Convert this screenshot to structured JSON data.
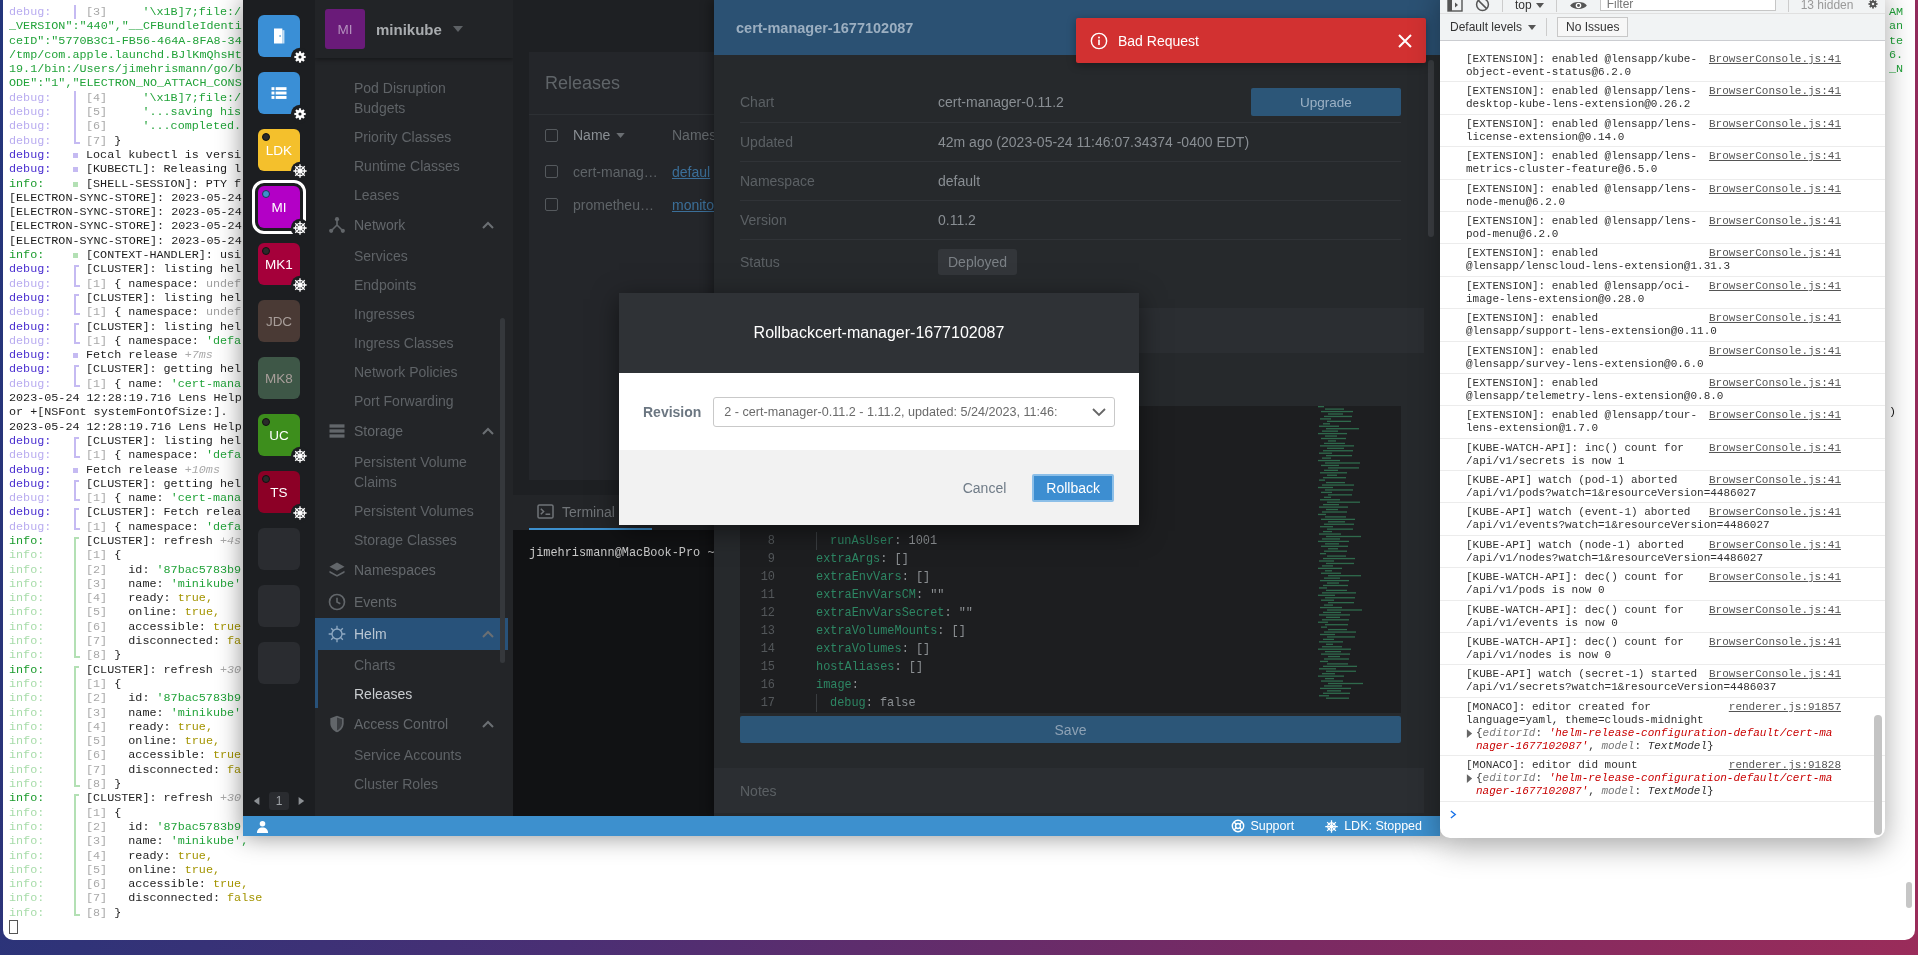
{
  "terminal": {
    "lines": [
      {
        "kind": "debug-sub",
        "label": "debug:",
        "marker": {
          "kind": "line"
        },
        "index": "[3]",
        "value": {
          "kind": "string",
          "text": "     '\\x1B]7;file:/"
        },
        "tail": {
          "kind": "string",
          "text": "AM"
        }
      },
      {
        "kind": "raw-string",
        "text": "_VERSION\":\"440\",\"__CFBundleIdenti",
        "tail": {
          "kind": "string",
          "text": "an"
        }
      },
      {
        "kind": "raw-string",
        "text": "ceID\":\"5770B3C1-FB56-464A-8FA8-34",
        "tail": {
          "kind": "string",
          "text": "te"
        }
      },
      {
        "kind": "raw-string",
        "text": "/tmp/com.apple.launchd.BJlKmQhsHt",
        "tail": {
          "kind": "string",
          "text": "6."
        }
      },
      {
        "kind": "raw-string",
        "text": "19.1/bin:/Users/jimehrismann/go/b",
        "tail": {
          "kind": "string",
          "text": "_N"
        }
      },
      {
        "kind": "raw-string",
        "text": "ODE\":\"1\",\"ELECTRON_NO_ATTACH_CONS"
      },
      {
        "kind": "debug-sub",
        "label": "debug:",
        "marker": {
          "kind": "line"
        },
        "index": "[4]",
        "value": {
          "kind": "string",
          "text": "     '\\x1B]7;file:/"
        }
      },
      {
        "kind": "debug-sub",
        "label": "debug:",
        "marker": {
          "kind": "line"
        },
        "index": "[5]",
        "value": {
          "kind": "string",
          "text": "     '...saving his"
        }
      },
      {
        "kind": "debug-sub",
        "label": "debug:",
        "marker": {
          "kind": "line"
        },
        "index": "[6]",
        "value": {
          "kind": "string",
          "text": "     '...completed."
        }
      },
      {
        "kind": "debug-sub",
        "label": "debug:",
        "marker": {
          "kind": "close"
        },
        "index": "[7]",
        "text": " }"
      },
      {
        "kind": "debug",
        "label": "debug:",
        "marker": {
          "kind": "dot"
        },
        "text": "Local kubectl is versi"
      },
      {
        "kind": "debug",
        "label": "debug:",
        "marker": {
          "kind": "dot"
        },
        "text": "[KUBECTL]: Releasing l"
      },
      {
        "kind": "info",
        "label": "info:",
        "marker": {
          "kind": "dot"
        },
        "text": "[SHELL-SESSION]: PTY f"
      },
      {
        "kind": "raw",
        "text": "[ELECTRON-SYNC-STORE]: 2023-05-24"
      },
      {
        "kind": "raw",
        "text": "[ELECTRON-SYNC-STORE]: 2023-05-24"
      },
      {
        "kind": "raw",
        "text": "[ELECTRON-SYNC-STORE]: 2023-05-24"
      },
      {
        "kind": "raw",
        "text": "[ELECTRON-SYNC-STORE]: 2023-05-24"
      },
      {
        "kind": "info",
        "label": "info:",
        "marker": {
          "kind": "dot"
        },
        "text": "[CONTEXT-HANDLER]: usi"
      },
      {
        "kind": "debug",
        "label": "debug:",
        "marker": {
          "kind": "open"
        },
        "text": "[CLUSTER]: listing hel"
      },
      {
        "kind": "debug-sub",
        "label": "debug:",
        "marker": {
          "kind": "close"
        },
        "index": "[1]",
        "text": " { namespace: ",
        "value": {
          "kind": "undefined",
          "text": "undef"
        }
      },
      {
        "kind": "debug",
        "label": "debug:",
        "marker": {
          "kind": "open"
        },
        "text": "[CLUSTER]: listing hel"
      },
      {
        "kind": "debug-sub",
        "label": "debug:",
        "marker": {
          "kind": "close"
        },
        "index": "[1]",
        "text": " { namespace: ",
        "value": {
          "kind": "undefined",
          "text": "undef"
        }
      },
      {
        "kind": "debug",
        "label": "debug:",
        "marker": {
          "kind": "open"
        },
        "text": "[CLUSTER]: listing hel"
      },
      {
        "kind": "debug-sub",
        "label": "debug:",
        "marker": {
          "kind": "close"
        },
        "index": "[1]",
        "text": " { namespace: ",
        "value": {
          "kind": "string",
          "text": "'defa"
        }
      },
      {
        "kind": "debug",
        "label": "debug:",
        "marker": {
          "kind": "dot"
        },
        "text": "Fetch release ",
        "value": {
          "kind": "timing",
          "text": "+7ms"
        }
      },
      {
        "kind": "debug",
        "label": "debug:",
        "marker": {
          "kind": "open"
        },
        "text": "[CLUSTER]: getting hel"
      },
      {
        "kind": "debug-sub",
        "label": "debug:",
        "marker": {
          "kind": "close"
        },
        "index": "[1]",
        "text": " { name: ",
        "value": {
          "kind": "string",
          "text": "'cert-mana"
        }
      },
      {
        "kind": "raw",
        "text": "2023-05-24 12:28:19.716 Lens Help"
      },
      {
        "kind": "raw",
        "text": "or +[NSFont systemFontOfSize:].",
        "tail": {
          "kind": "plain",
          "text": ")"
        }
      },
      {
        "kind": "raw",
        "text": "2023-05-24 12:28:19.716 Lens Help"
      },
      {
        "kind": "debug",
        "label": "debug:",
        "marker": {
          "kind": "open"
        },
        "text": "[CLUSTER]: listing hel"
      },
      {
        "kind": "debug-sub",
        "label": "debug:",
        "marker": {
          "kind": "close"
        },
        "index": "[1]",
        "text": " { namespace: ",
        "value": {
          "kind": "string",
          "text": "'defa"
        }
      },
      {
        "kind": "debug",
        "label": "debug:",
        "marker": {
          "kind": "dot"
        },
        "text": "Fetch release ",
        "value": {
          "kind": "timing",
          "text": "+10ms"
        }
      },
      {
        "kind": "debug",
        "label": "debug:",
        "marker": {
          "kind": "open"
        },
        "text": "[CLUSTER]: getting hel"
      },
      {
        "kind": "debug-sub",
        "label": "debug:",
        "marker": {
          "kind": "close"
        },
        "index": "[1]",
        "text": " { name: ",
        "value": {
          "kind": "string",
          "text": "'cert-mana"
        }
      },
      {
        "kind": "debug",
        "label": "debug:",
        "marker": {
          "kind": "open"
        },
        "text": "[CLUSTER]: Fetch relea"
      },
      {
        "kind": "debug-sub",
        "label": "debug:",
        "marker": {
          "kind": "close"
        },
        "index": "[1]",
        "text": " { namespace: ",
        "value": {
          "kind": "string",
          "text": "'defa"
        }
      },
      {
        "kind": "info",
        "label": "info:",
        "marker": {
          "kind": "open"
        },
        "text": "[CLUSTER]: refresh ",
        "value": {
          "kind": "timing",
          "text": "+4s"
        }
      },
      {
        "kind": "info-sub",
        "label": "info:",
        "marker": {
          "kind": "line"
        },
        "index": "[1]",
        "text": " {"
      },
      {
        "kind": "info-sub",
        "label": "info:",
        "marker": {
          "kind": "line"
        },
        "index": "[2]",
        "text": "   id: ",
        "value": {
          "kind": "string",
          "text": "'87bac5783b9"
        }
      },
      {
        "kind": "info-sub",
        "label": "info:",
        "marker": {
          "kind": "line"
        },
        "index": "[3]",
        "text": "   name: ",
        "value": {
          "kind": "string",
          "text": "'minikube'"
        }
      },
      {
        "kind": "info-sub",
        "label": "info:",
        "marker": {
          "kind": "line"
        },
        "index": "[4]",
        "text": "   ready: ",
        "value": {
          "kind": "boolean",
          "text": "true,"
        }
      },
      {
        "kind": "info-sub",
        "label": "info:",
        "marker": {
          "kind": "line"
        },
        "index": "[5]",
        "text": "   online: ",
        "value": {
          "kind": "boolean",
          "text": "true,"
        }
      },
      {
        "kind": "info-sub",
        "label": "info:",
        "marker": {
          "kind": "line"
        },
        "index": "[6]",
        "text": "   accessible: ",
        "value": {
          "kind": "boolean",
          "text": "true"
        }
      },
      {
        "kind": "info-sub",
        "label": "info:",
        "marker": {
          "kind": "line"
        },
        "index": "[7]",
        "text": "   disconnected: ",
        "value": {
          "kind": "boolean",
          "text": "fa"
        }
      },
      {
        "kind": "info-sub",
        "label": "info:",
        "marker": {
          "kind": "close"
        },
        "index": "[8]",
        "text": " }"
      },
      {
        "kind": "info",
        "label": "info:",
        "marker": {
          "kind": "open"
        },
        "text": "[CLUSTER]: refresh ",
        "value": {
          "kind": "timing",
          "text": "+30"
        }
      },
      {
        "kind": "info-sub",
        "label": "info:",
        "marker": {
          "kind": "line"
        },
        "index": "[1]",
        "text": " {"
      },
      {
        "kind": "info-sub",
        "label": "info:",
        "marker": {
          "kind": "line"
        },
        "index": "[2]",
        "text": "   id: ",
        "value": {
          "kind": "string",
          "text": "'87bac5783b9"
        }
      },
      {
        "kind": "info-sub",
        "label": "info:",
        "marker": {
          "kind": "line"
        },
        "index": "[3]",
        "text": "   name: ",
        "value": {
          "kind": "string",
          "text": "'minikube'"
        }
      },
      {
        "kind": "info-sub",
        "label": "info:",
        "marker": {
          "kind": "line"
        },
        "index": "[4]",
        "text": "   ready: ",
        "value": {
          "kind": "boolean",
          "text": "true,"
        }
      },
      {
        "kind": "info-sub",
        "label": "info:",
        "marker": {
          "kind": "line"
        },
        "index": "[5]",
        "text": "   online: ",
        "value": {
          "kind": "boolean",
          "text": "true,"
        }
      },
      {
        "kind": "info-sub",
        "label": "info:",
        "marker": {
          "kind": "line"
        },
        "index": "[6]",
        "text": "   accessible: ",
        "value": {
          "kind": "boolean",
          "text": "true"
        }
      },
      {
        "kind": "info-sub",
        "label": "info:",
        "marker": {
          "kind": "line"
        },
        "index": "[7]",
        "text": "   disconnected: ",
        "value": {
          "kind": "boolean",
          "text": "fa"
        }
      },
      {
        "kind": "info-sub",
        "label": "info:",
        "marker": {
          "kind": "close"
        },
        "index": "[8]",
        "text": " }"
      },
      {
        "kind": "info",
        "label": "info:",
        "marker": {
          "kind": "open"
        },
        "text": "[CLUSTER]: refresh ",
        "value": {
          "kind": "timing",
          "text": "+30"
        }
      },
      {
        "kind": "info-sub",
        "label": "info:",
        "marker": {
          "kind": "line"
        },
        "index": "[1]",
        "text": " {"
      },
      {
        "kind": "info-sub",
        "label": "info:",
        "marker": {
          "kind": "line"
        },
        "index": "[2]",
        "text": "   id: ",
        "value": {
          "kind": "string",
          "text": "'87bac5783b9"
        }
      },
      {
        "kind": "info-sub",
        "label": "info:",
        "marker": {
          "kind": "line"
        },
        "index": "[3]",
        "text": "   name: ",
        "value": {
          "kind": "string",
          "text": "'minikube',"
        }
      },
      {
        "kind": "info-sub",
        "label": "info:",
        "marker": {
          "kind": "line"
        },
        "index": "[4]",
        "text": "   ready: ",
        "value": {
          "kind": "boolean",
          "text": "true,"
        }
      },
      {
        "kind": "info-sub",
        "label": "info:",
        "marker": {
          "kind": "line"
        },
        "index": "[5]",
        "text": "   online: ",
        "value": {
          "kind": "boolean",
          "text": "true,"
        }
      },
      {
        "kind": "info-sub",
        "label": "info:",
        "marker": {
          "kind": "line"
        },
        "index": "[6]",
        "text": "   accessible: ",
        "value": {
          "kind": "boolean",
          "text": "true,"
        }
      },
      {
        "kind": "info-sub",
        "label": "info:",
        "marker": {
          "kind": "line"
        },
        "index": "[7]",
        "text": "   disconnected: ",
        "value": {
          "kind": "boolean",
          "text": "false"
        }
      },
      {
        "kind": "info-sub",
        "label": "info:",
        "marker": {
          "kind": "close"
        },
        "index": "[8]",
        "text": " }"
      },
      {
        "kind": "cursor"
      }
    ]
  },
  "lens": {
    "hotbar": {
      "items": [
        {
          "kind": "door",
          "color": "#3a8fd6",
          "badge": {
            "kind": "gear"
          },
          "selected": false
        },
        {
          "kind": "list",
          "color": "#3a8fd6",
          "badge": {
            "kind": "gear"
          },
          "selected": false
        },
        {
          "kind": "cluster",
          "initials": "LDK",
          "color": "#f4c02c",
          "badge": {
            "kind": "kube"
          },
          "status": {
            "kind": "disconnected"
          },
          "selected": false
        },
        {
          "kind": "cluster",
          "initials": "MI",
          "color": "#b300c6",
          "badge": {
            "kind": "kube"
          },
          "status": {
            "kind": "connected"
          },
          "selected": true
        },
        {
          "kind": "cluster",
          "initials": "MK1",
          "color": "#a5003a",
          "badge": {
            "kind": "kube"
          },
          "status": {
            "kind": "disconnected"
          },
          "selected": false
        },
        {
          "kind": "cluster",
          "initials": "JDC",
          "color": "#4a3a35",
          "selected": false
        },
        {
          "kind": "cluster",
          "initials": "MK8",
          "color": "#3e5747",
          "selected": false
        },
        {
          "kind": "cluster",
          "initials": "UC",
          "color": "#3d8e1c",
          "badge": {
            "kind": "kube"
          },
          "status": {
            "kind": "disconnected"
          },
          "selected": false
        },
        {
          "kind": "cluster",
          "initials": "TS",
          "color": "#8c0026",
          "badge": {
            "kind": "kube"
          },
          "status": {
            "kind": "disconnected"
          },
          "selected": false
        },
        {
          "kind": "empty",
          "selected": false
        },
        {
          "kind": "empty",
          "selected": false
        },
        {
          "kind": "empty",
          "selected": false
        }
      ],
      "page": "1"
    },
    "cluster": {
      "initials": "MI",
      "name": "minikube"
    },
    "sidebar": {
      "items": [
        {
          "children": [
            {
              "label": "Pod Disruption Budgets",
              "selected": false
            },
            {
              "label": "Priority Classes",
              "selected": false
            },
            {
              "label": "Runtime Classes",
              "selected": false
            },
            {
              "label": "Leases",
              "selected": false
            }
          ]
        },
        {
          "kind": "network",
          "label": "Network",
          "expanded": true,
          "selected": false,
          "children": [
            {
              "label": "Services",
              "selected": false
            },
            {
              "label": "Endpoints",
              "selected": false
            },
            {
              "label": "Ingresses",
              "selected": false
            },
            {
              "label": "Ingress Classes",
              "selected": false
            },
            {
              "label": "Network Policies",
              "selected": false
            },
            {
              "label": "Port Forwarding",
              "selected": false
            }
          ]
        },
        {
          "kind": "storage",
          "label": "Storage",
          "expanded": true,
          "selected": false,
          "children": [
            {
              "label": "Persistent Volume Claims",
              "selected": false
            },
            {
              "label": "Persistent Volumes",
              "selected": false
            },
            {
              "label": "Storage Classes",
              "selected": false
            }
          ]
        },
        {
          "kind": "namespaces",
          "label": "Namespaces",
          "selected": false
        },
        {
          "kind": "events",
          "label": "Events",
          "selected": false
        },
        {
          "kind": "helm",
          "label": "Helm",
          "expanded": true,
          "selected": true,
          "children": [
            {
              "label": "Charts",
              "selected": false
            },
            {
              "label": "Releases",
              "selected": true
            }
          ]
        },
        {
          "kind": "access-control",
          "label": "Access Control",
          "expanded": true,
          "selected": false,
          "children": [
            {
              "label": "Service Accounts",
              "selected": false
            },
            {
              "label": "Cluster Roles",
              "selected": false
            }
          ]
        }
      ]
    },
    "releases": {
      "title": "Releases",
      "select_all_checked": false,
      "columns": [
        {
          "label": "Name",
          "sorted": true
        },
        {
          "label": "Names",
          "sorted": false
        }
      ],
      "rows": [
        {
          "checked": false,
          "name": "cert-manag…",
          "column_2": "defaul"
        },
        {
          "checked": false,
          "name": "prometheu…",
          "column_2": "monito"
        }
      ]
    },
    "dock": {
      "tabs": [
        {
          "label": "Terminal",
          "selected": true
        }
      ],
      "prompt": "jimehrismann@MacBook-Pro ~"
    },
    "drawer": {
      "title": "cert-manager-1677102087",
      "details": [
        {
          "label": "Chart",
          "value": "cert-manager-0.11.2",
          "kind": "text",
          "action": "Upgrade"
        },
        {
          "label": "Updated",
          "value": "42m ago (2023-05-24 11:46:07.34374 -0400 EDT)",
          "kind": "text"
        },
        {
          "label": "Namespace",
          "value": "default",
          "kind": "text"
        },
        {
          "label": "Version",
          "value": "0.11.2",
          "kind": "text"
        },
        {
          "label": "Status",
          "value": "Deployed",
          "kind": "badge"
        }
      ],
      "editor": {
        "lines": [
          {
            "number": "8",
            "key": "runAsUser",
            "value": ": 1001",
            "nested": true
          },
          {
            "number": "9",
            "key": "extraArgs",
            "value": ": []",
            "nested": false
          },
          {
            "number": "10",
            "key": "extraEnvVars",
            "value": ": []",
            "nested": false
          },
          {
            "number": "11",
            "key": "extraEnvVarsCM",
            "value": ": \"\"",
            "nested": false
          },
          {
            "number": "12",
            "key": "extraEnvVarsSecret",
            "value": ": \"\"",
            "nested": false
          },
          {
            "number": "13",
            "key": "extraVolumeMounts",
            "value": ": []",
            "nested": false
          },
          {
            "number": "14",
            "key": "extraVolumes",
            "value": ": []",
            "nested": false
          },
          {
            "number": "15",
            "key": "hostAliases",
            "value": ": []",
            "nested": false
          },
          {
            "number": "16",
            "key": "image",
            "value": ":",
            "nested": false
          },
          {
            "number": "17",
            "key": "debug",
            "value": ": false",
            "nested": true
          }
        ]
      },
      "save": "Save",
      "notes_title": "Notes"
    },
    "toast": {
      "message": "Bad Request"
    },
    "modal": {
      "title": "Rollbackcert-manager-1677102087",
      "field_label": "Revision",
      "select_value": "2 - cert-manager-0.11.2 - 1.11.2, updated: 5/24/2023, 11:46:",
      "buttons": [
        {
          "label": "Cancel",
          "kind": "flat"
        },
        {
          "label": "Rollback",
          "kind": "primary"
        }
      ]
    },
    "status_bar": {
      "items": [
        {
          "kind": "support",
          "label": "Support"
        },
        {
          "kind": "cluster",
          "label": "LDK: Stopped"
        }
      ]
    }
  },
  "devtools": {
    "context": "top",
    "filter": {
      "placeholder": "Filter"
    },
    "hidden_count": "13 hidden",
    "levels": "Default levels",
    "issues": "No Issues",
    "messages": [
      {
        "lines": [
          "[EXTENSION]: enabled @lensapp/kube-",
          "object-event-status@6.2.0"
        ],
        "source": "BrowserConsole.js:41"
      },
      {
        "lines": [
          "[EXTENSION]: enabled @lensapp/lens-",
          "desktop-kube-lens-extension@0.26.2"
        ],
        "source": "BrowserConsole.js:41"
      },
      {
        "lines": [
          "[EXTENSION]: enabled @lensapp/lens-",
          "license-extension@0.14.0"
        ],
        "source": "BrowserConsole.js:41"
      },
      {
        "lines": [
          "[EXTENSION]: enabled @lensapp/lens-",
          "metrics-cluster-feature@6.5.0"
        ],
        "source": "BrowserConsole.js:41"
      },
      {
        "lines": [
          "[EXTENSION]: enabled @lensapp/lens-",
          "node-menu@6.2.0"
        ],
        "source": "BrowserConsole.js:41"
      },
      {
        "lines": [
          "[EXTENSION]: enabled @lensapp/lens-",
          "pod-menu@6.2.0"
        ],
        "source": "BrowserConsole.js:41"
      },
      {
        "lines": [
          "[EXTENSION]: enabled",
          "@lensapp/lenscloud-lens-extension@1.31.3"
        ],
        "source": "BrowserConsole.js:41"
      },
      {
        "lines": [
          "[EXTENSION]: enabled @lensapp/oci-",
          "image-lens-extension@0.28.0"
        ],
        "source": "BrowserConsole.js:41"
      },
      {
        "lines": [
          "[EXTENSION]: enabled",
          "@lensapp/support-lens-extension@0.11.0"
        ],
        "source": "BrowserConsole.js:41"
      },
      {
        "lines": [
          "[EXTENSION]: enabled",
          "@lensapp/survey-lens-extension@0.6.0"
        ],
        "source": "BrowserConsole.js:41"
      },
      {
        "lines": [
          "[EXTENSION]: enabled",
          "@lensapp/telemetry-lens-extension@0.8.0"
        ],
        "source": "BrowserConsole.js:41"
      },
      {
        "lines": [
          "[EXTENSION]: enabled @lensapp/tour-",
          "lens-extension@1.7.0"
        ],
        "source": "BrowserConsole.js:41"
      },
      {
        "lines": [
          "[KUBE-WATCH-API]: inc() count for",
          "/api/v1/secrets is now 1"
        ],
        "source": "BrowserConsole.js:41"
      },
      {
        "lines": [
          "[KUBE-API] watch (pod-1) aborted",
          "/api/v1/pods?watch=1&resourceVersion=4486027"
        ],
        "source": "BrowserConsole.js:41"
      },
      {
        "lines": [
          "[KUBE-API] watch (event-1) aborted",
          "/api/v1/events?watch=1&resourceVersion=4486027"
        ],
        "source": "BrowserConsole.js:41"
      },
      {
        "lines": [
          "[KUBE-API] watch (node-1) aborted",
          "/api/v1/nodes?watch=1&resourceVersion=4486027"
        ],
        "source": "BrowserConsole.js:41"
      },
      {
        "lines": [
          "[KUBE-WATCH-API]: dec() count for",
          "/api/v1/pods is now 0"
        ],
        "source": "BrowserConsole.js:41"
      },
      {
        "lines": [
          "[KUBE-WATCH-API]: dec() count for",
          "/api/v1/events is now 0"
        ],
        "source": "BrowserConsole.js:41"
      },
      {
        "lines": [
          "[KUBE-WATCH-API]: dec() count for",
          "/api/v1/nodes is now 0"
        ],
        "source": "BrowserConsole.js:41"
      },
      {
        "lines": [
          "[KUBE-API] watch (secret-1) started",
          "/api/v1/secrets?watch=1&resourceVersion=4486037"
        ],
        "source": "BrowserConsole.js:41"
      },
      {
        "lines": [
          "[MONACO]: editor created for",
          "language=yaml, theme=clouds-midnight"
        ],
        "source": "renderer.js:91857",
        "preview": {
          "expanded": false,
          "parts": [
            {
              "kind": "punct",
              "text": "{"
            },
            {
              "kind": "key",
              "text": "editorId"
            },
            {
              "kind": "punct",
              "text": ": "
            },
            {
              "kind": "string",
              "text": "'helm-release-configuration-default/cert-manager-1677102087'"
            },
            {
              "kind": "punct",
              "text": ", "
            },
            {
              "kind": "key",
              "text": "model"
            },
            {
              "kind": "punct",
              "text": ": "
            },
            {
              "kind": "plain",
              "text": "TextModel"
            },
            {
              "kind": "punct",
              "text": "}"
            }
          ]
        }
      },
      {
        "lines": [
          "[MONACO]: editor did mount"
        ],
        "source": "renderer.js:91828",
        "preview": {
          "expanded": false,
          "parts": [
            {
              "kind": "punct",
              "text": "{"
            },
            {
              "kind": "key",
              "text": "editorId"
            },
            {
              "kind": "punct",
              "text": ": "
            },
            {
              "kind": "string",
              "text": "'helm-release-configuration-default/cert-manager-1677102087'"
            },
            {
              "kind": "punct",
              "text": ", "
            },
            {
              "kind": "key",
              "text": "model"
            },
            {
              "kind": "punct",
              "text": ": "
            },
            {
              "kind": "plain",
              "text": "TextModel"
            },
            {
              "kind": "punct",
              "text": "}"
            }
          ]
        }
      }
    ]
  }
}
